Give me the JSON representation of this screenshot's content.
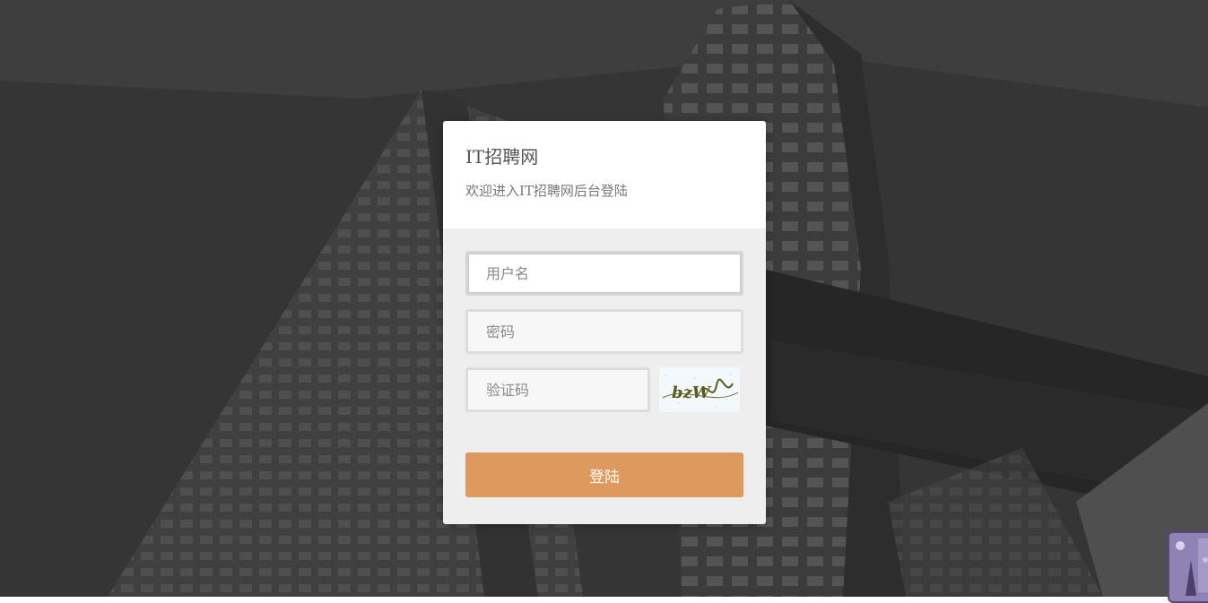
{
  "header": {
    "title": "IT招聘网",
    "subtitle": "欢迎进入IT招聘网后台登陆"
  },
  "form": {
    "username_placeholder": "用户名",
    "password_placeholder": "密码",
    "captcha_placeholder": "验证码",
    "captcha_text": "bzW",
    "submit_label": "登陆"
  },
  "colors": {
    "accent": "#de9a5e",
    "background": "#3c3c3c",
    "panel": "#eeeeee"
  },
  "icons": {
    "captcha": "captcha-image",
    "corner_widget": "decorative-widget-icon"
  }
}
